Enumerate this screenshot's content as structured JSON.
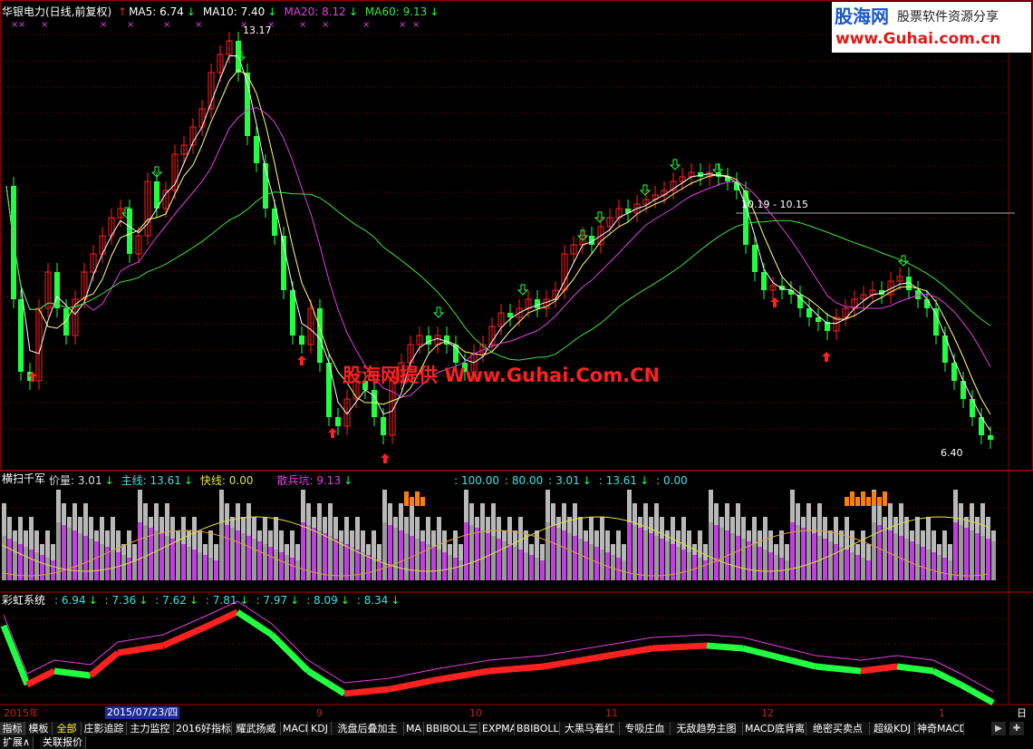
{
  "window": {
    "title": "华银电力(日线,前复权)"
  },
  "main_panel": {
    "legend": [
      {
        "text": "MA5: 6.74",
        "color": "#ffffff",
        "arrow": "down"
      },
      {
        "text": "MA10: 7.40",
        "color": "#ffffff",
        "arrow": "down"
      },
      {
        "text": "MA20: 8.12",
        "color": "#e040e0",
        "arrow": "down"
      },
      {
        "text": "MA60: 9.13",
        "color": "#40e040",
        "arrow": "down"
      }
    ],
    "annotations": {
      "high": "13.17",
      "range": "10.19 - 10.15",
      "low": "6.40"
    },
    "watermark": "股海网提供 Www.Guhai.Com.CN"
  },
  "logo": {
    "name": "股海网",
    "slogan": "股票软件资源分享",
    "url": "www.Guhai.com.cn"
  },
  "indicator1": {
    "name": "横扫千军",
    "items": [
      {
        "text": "价量: 3.01",
        "color": "#dddddd",
        "arrow": "down"
      },
      {
        "text": "主线: 13.61",
        "color": "#40e0e0",
        "arrow": "down"
      },
      {
        "text": "快线: 0.00",
        "color": "#e0e040",
        "arrow": ""
      },
      {
        "text": "散兵坑: 9.13",
        "color": "#e040e0",
        "arrow": "down"
      },
      {
        "text": ": 100.00",
        "color": "#40e0e0",
        "arrow": ""
      },
      {
        "text": ": 80.00",
        "color": "#40e0e0",
        "arrow": ""
      },
      {
        "text": ": 3.01",
        "color": "#40e0e0",
        "arrow": "down"
      },
      {
        "text": ": 13.61",
        "color": "#40e0e0",
        "arrow": "down"
      },
      {
        "text": ": 0.00",
        "color": "#40e0e0",
        "arrow": ""
      }
    ]
  },
  "indicator2": {
    "name": "彩虹系统",
    "items": [
      {
        "text": ": 6.94",
        "arrow": "down"
      },
      {
        "text": ": 7.36",
        "arrow": "down"
      },
      {
        "text": ": 7.62",
        "arrow": "down"
      },
      {
        "text": ": 7.81",
        "arrow": "down"
      },
      {
        "text": ": 7.97",
        "arrow": "down"
      },
      {
        "text": ": 8.09",
        "arrow": "down"
      },
      {
        "text": ": 8.34",
        "arrow": "down"
      }
    ]
  },
  "time_axis": {
    "labels": [
      "2015年",
      "9",
      "10",
      "11",
      "12",
      "1"
    ],
    "cursor_date": "2015/07/23/四",
    "corner": "日"
  },
  "tabs": [
    "指标",
    "模板",
    "全部",
    "庄影追踪",
    "主力监控",
    "2016好指标",
    "耀武扬威",
    "MACD",
    "KDJ",
    "洗盘后叠加主",
    "MA",
    "BBIBOLL三",
    "EXPMA",
    "BBIBOLL",
    "大黑马看红",
    "专吸庄血",
    "无敌趋势主图",
    "MACD底背离",
    "绝密买卖点",
    "超级KDJ",
    "神奇MACD"
  ],
  "bottom_buttons": [
    "扩展∧",
    "关联报价"
  ],
  "colors": {
    "up": "#ff2020",
    "down": "#20ff40",
    "ma5": "#ffffff",
    "ma10": "#ffff80",
    "ma20": "#e040e0",
    "ma60": "#40e040",
    "grid": "#8b0000"
  }
}
